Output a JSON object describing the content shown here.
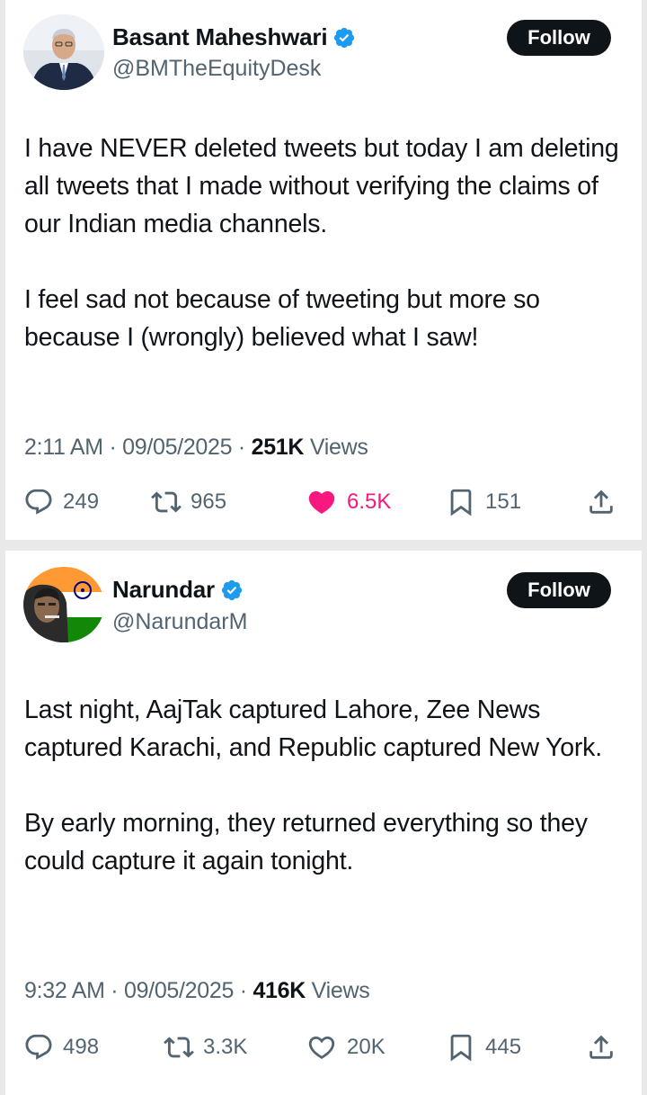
{
  "tweets": [
    {
      "author": {
        "name": "Basant Maheshwari",
        "handle": "@BMTheEquityDesk",
        "verified": true
      },
      "follow_label": "Follow",
      "paragraphs": [
        "I have NEVER deleted tweets but today I am deleting all tweets that I made without verifying the claims of our Indian media channels.",
        "I feel sad not because of tweeting but more so because I (wrongly) believed what I saw!"
      ],
      "time": "2:11 AM",
      "date": "09/05/2025",
      "views_count": "251K",
      "views_label": "Views",
      "stats": {
        "replies": "249",
        "retweets": "965",
        "likes": "6.5K",
        "bookmarks": "151"
      },
      "liked": true
    },
    {
      "author": {
        "name": "Narundar",
        "handle": "@NarundarM",
        "verified": true
      },
      "follow_label": "Follow",
      "paragraphs": [
        "Last night, AajTak captured Lahore, Zee News captured Karachi, and Republic captured New York.",
        "By early morning, they returned everything so they could capture it again tonight."
      ],
      "time": "9:32 AM",
      "date": "09/05/2025",
      "views_count": "416K",
      "views_label": "Views",
      "stats": {
        "replies": "498",
        "retweets": "3.3K",
        "likes": "20K",
        "bookmarks": "445"
      },
      "liked": false
    }
  ],
  "separator": "·",
  "colors": {
    "accent_verified": "#1d9bf0",
    "like_active": "#f91880",
    "text_secondary": "#536471"
  },
  "icons": [
    "verified-badge-icon",
    "reply-icon",
    "retweet-icon",
    "like-icon",
    "bookmark-icon",
    "share-icon"
  ]
}
